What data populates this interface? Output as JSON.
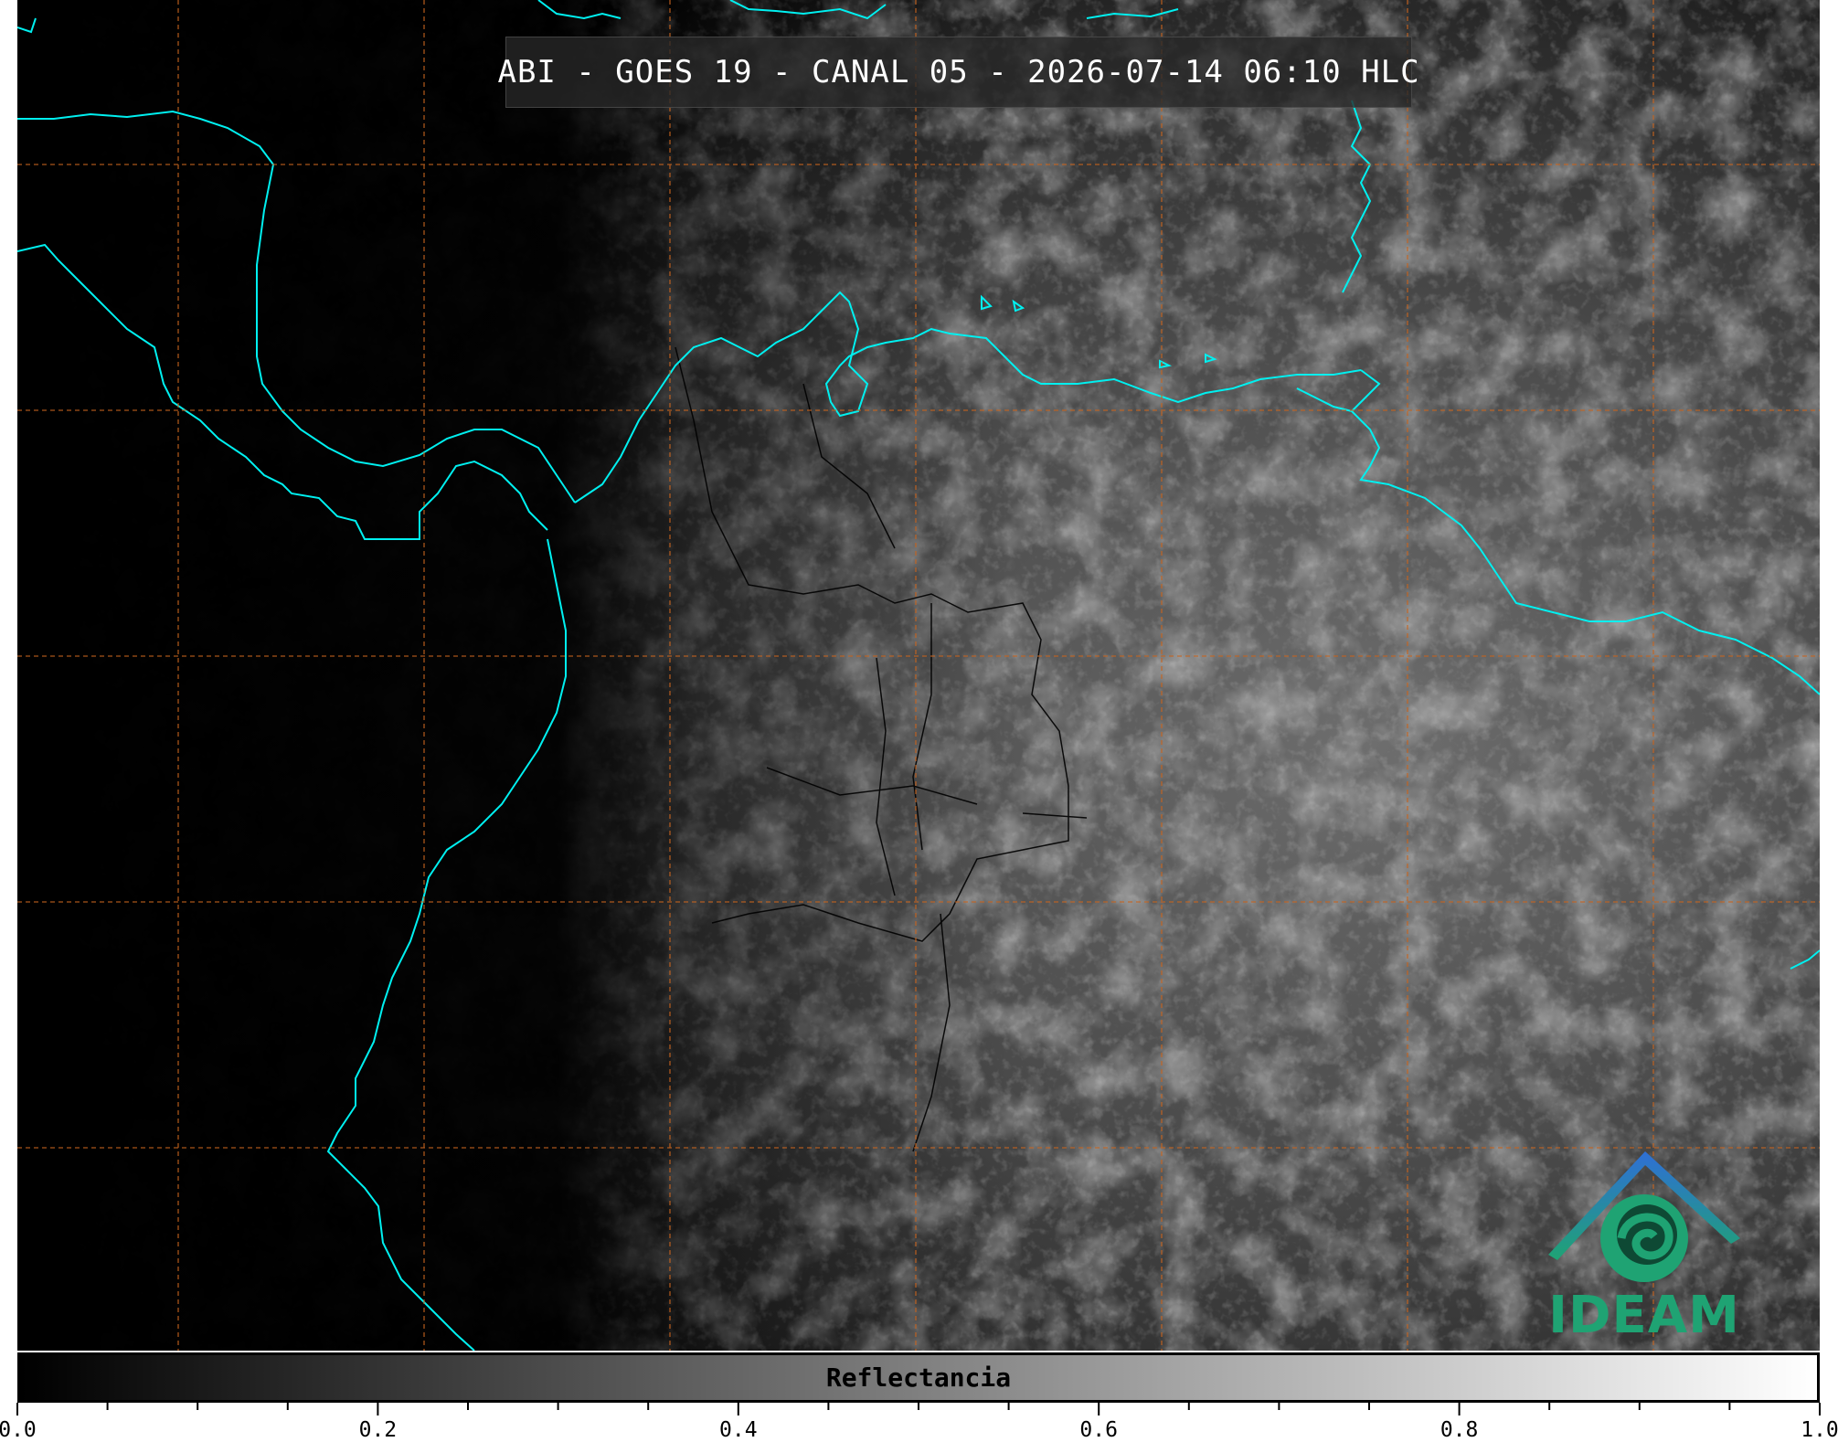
{
  "title": "ABI - GOES 19 - CANAL 05 - 2026-07-14 06:10 HLC",
  "colorbar": {
    "label": "Reflectancia",
    "range": [
      0.0,
      1.0
    ],
    "ticks": [
      "0.0",
      "0.2",
      "0.4",
      "0.6",
      "0.8",
      "1.0"
    ],
    "colors": {
      "low": "#000000",
      "high": "#ffffff"
    }
  },
  "logo": {
    "text": "IDEAM",
    "colors": {
      "roof": "#2f6fd6",
      "swirl": "#1fa373"
    }
  },
  "colors": {
    "coastline": "#00f0f0",
    "gridlines": "#c8641e",
    "borders": "#000000"
  }
}
